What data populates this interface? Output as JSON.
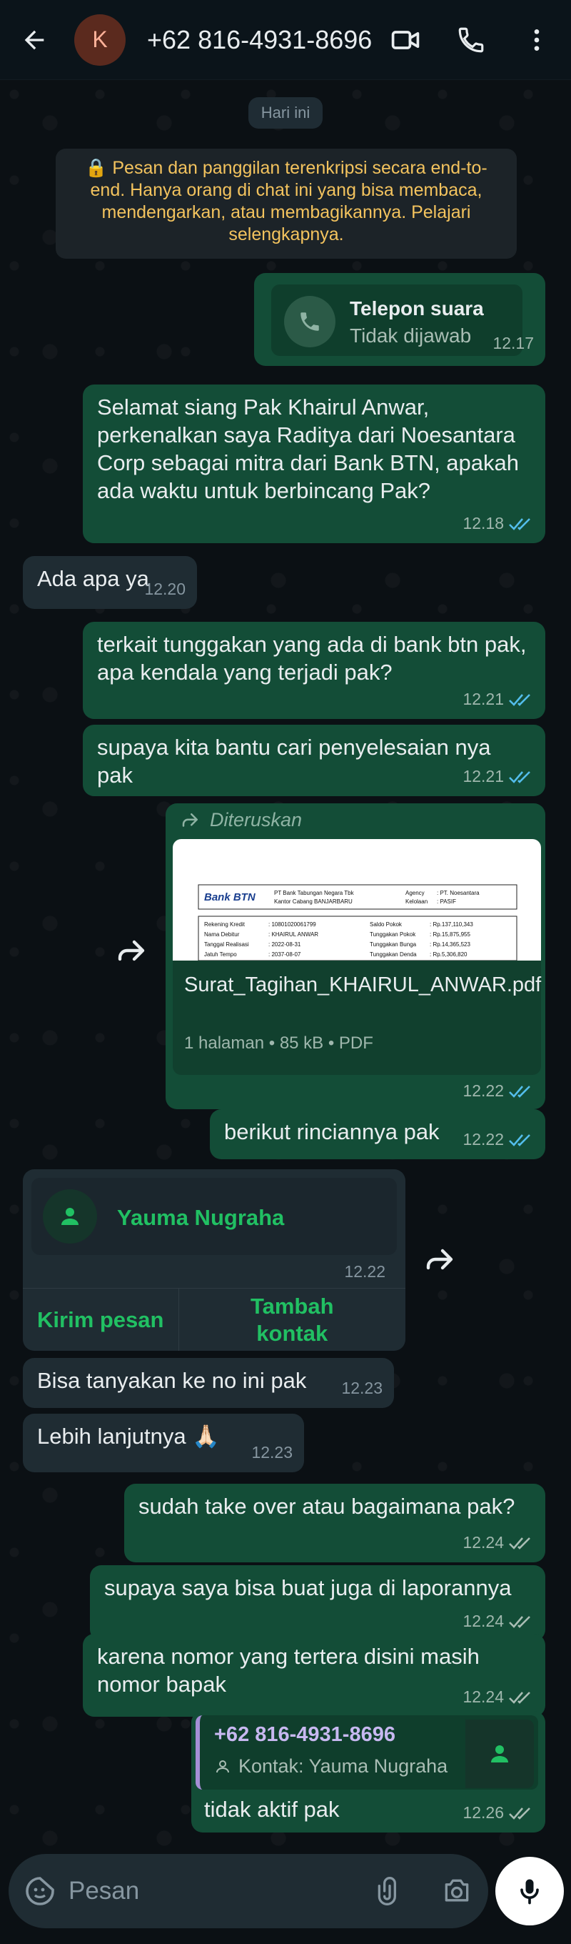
{
  "header": {
    "avatar_initial": "K",
    "title": "+62 816-4931-8696",
    "icons": [
      "back-arrow-icon",
      "video-call-icon",
      "phone-icon",
      "more-vert-icon"
    ]
  },
  "chat": {
    "date_chip": "Hari ini",
    "encryption_notice": "🔒 Pesan dan panggilan terenkripsi secara end-to-end. Hanya orang di chat ini yang bisa membaca, mendengarkan, atau membagikannya. Pelajari selengkapnya.",
    "call": {
      "title": "Telepon suara",
      "subtitle": "Tidak dijawab",
      "time": "12.17"
    },
    "m1": {
      "text": "Selamat siang Pak Khairul Anwar, perkenalkan saya Raditya dari Noesantara Corp sebagai mitra dari Bank BTN, apakah ada waktu untuk berbincang Pak?",
      "time": "12.18"
    },
    "m2": {
      "text": "Ada apa ya",
      "time": "12.20"
    },
    "m3": {
      "text": "terkait tunggakan yang ada di bank btn pak, apa kendala yang terjadi pak?",
      "time": "12.21"
    },
    "m4": {
      "text": "supaya kita bantu cari penyelesaian nya pak",
      "time": "12.21"
    },
    "doc": {
      "forwarded_label": "Diteruskan",
      "filename": "Surat_Tagihan_KHAIRUL_ANWAR.pdf",
      "meta": "1 halaman • 85 kB • PDF",
      "time": "12.22",
      "preview": {
        "bank_logo": "Bank BTN",
        "bank_name": "PT Bank Tabungan Negara Tbk",
        "branch": "Kantor Cabang BANJARBARU",
        "agency_label": "Agency",
        "agency_value": ": PT. Noesantara",
        "kelolaan_label": "Kelolaan",
        "kelolaan_value": ": PASIF",
        "rows_left": [
          [
            "Rekening Kredit",
            ": 10801020061799"
          ],
          [
            "Nama Debitur",
            ": KHAIRUL ANWAR"
          ],
          [
            "Tanggal Realisasi",
            ": 2022-08-31"
          ],
          [
            "Jatuh Tempo",
            ": 2037-08-07"
          ]
        ],
        "rows_right": [
          [
            "Saldo Pokok",
            ": Rp.137,110,343"
          ],
          [
            "Tunggakan Pokok",
            ": Rp.15,875,955"
          ],
          [
            "Tunggakan Bunga",
            ": Rp.14,365,523"
          ],
          [
            "Tunggakan Denda",
            ": Rp.5,306,820"
          ]
        ]
      }
    },
    "m5": {
      "text": "berikut rinciannya pak",
      "time": "12.22"
    },
    "contact": {
      "name": "Yauma Nugraha",
      "time": "12.22",
      "send_label": "Kirim pesan",
      "add_label": "Tambah kontak"
    },
    "m6": {
      "text": "Bisa tanyakan ke no ini pak",
      "time": "12.23"
    },
    "m7": {
      "text": "Lebih lanjutnya 🙏🏻",
      "time": "12.23"
    },
    "m8": {
      "text": "sudah take over atau bagaimana pak?",
      "time": "12.24"
    },
    "m9": {
      "text": "supaya saya bisa buat juga di laporannya",
      "time": "12.24"
    },
    "m10": {
      "text": "karena nomor yang tertera disini masih nomor bapak",
      "time": "12.24"
    },
    "m11": {
      "quote_name": "+62 816-4931-8696",
      "quote_sub": "Kontak: Yauma Nugraha",
      "text": "tidak aktif pak",
      "time": "12.26"
    }
  },
  "composer": {
    "placeholder": "Pesan"
  },
  "colors": {
    "outgoing": "#134d37",
    "incoming": "#1f2c33",
    "accent": "#21c063",
    "read_ticks": "#53bdeb"
  }
}
